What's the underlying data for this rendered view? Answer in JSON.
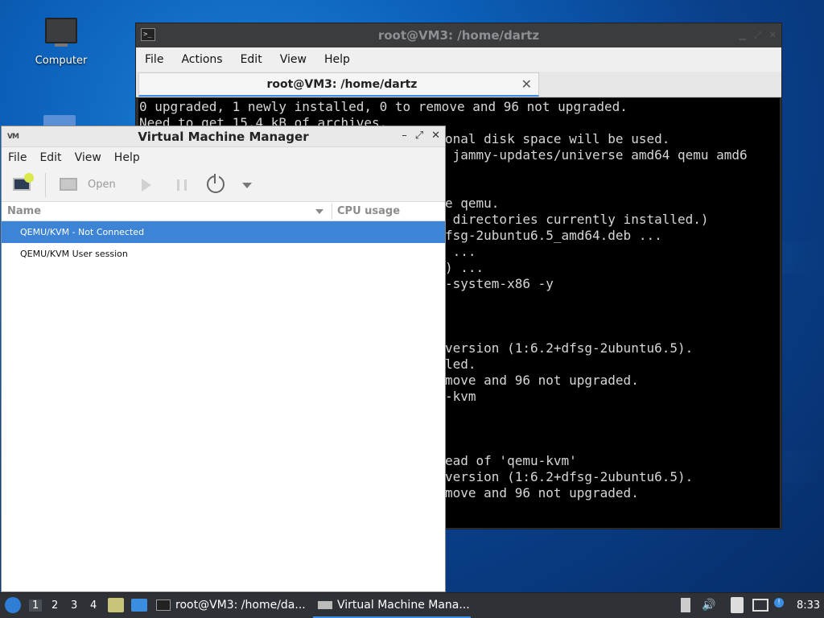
{
  "desktop": {
    "computer_icon_label": "Computer"
  },
  "terminal": {
    "title": "root@VM3: /home/dartz",
    "menu": [
      "File",
      "Actions",
      "Edit",
      "View",
      "Help"
    ],
    "tab_label": "root@VM3: /home/dartz",
    "lines": [
      "0 upgraded, 1 newly installed, 0 to remove and 96 not upgraded.",
      "Need to get 15.4 kB of archives.",
      "onal disk space will be used.",
      " jammy-updates/universe amd64 qemu amd6",
      "e qemu.",
      " directories currently installed.)",
      "fsg-2ubuntu6.5_amd64.deb ...",
      " ...",
      ") ...",
      "-system-x86 -y",
      "version (1:6.2+dfsg-2ubuntu6.5).",
      "led.",
      "move and 96 not upgraded.",
      "-kvm",
      "ead of 'qemu-kvm'",
      "version (1:6.2+dfsg-2ubuntu6.5).",
      "move and 96 not upgraded."
    ]
  },
  "vmm": {
    "title": "Virtual Machine Manager",
    "menu": [
      "File",
      "Edit",
      "View",
      "Help"
    ],
    "toolbar": {
      "open_label": "Open"
    },
    "columns": {
      "name": "Name",
      "cpu": "CPU usage"
    },
    "rows": [
      "QEMU/KVM - Not Connected",
      "QEMU/KVM User session"
    ]
  },
  "taskbar": {
    "workspaces": [
      "1",
      "2",
      "3",
      "4"
    ],
    "tasks": [
      "root@VM3: /home/da...",
      "Virtual Machine Mana..."
    ],
    "clock": "8:33"
  },
  "colors": {
    "selection": "#3d84d6",
    "accent": "#3a8ee6",
    "terminal_bg": "#000000"
  }
}
